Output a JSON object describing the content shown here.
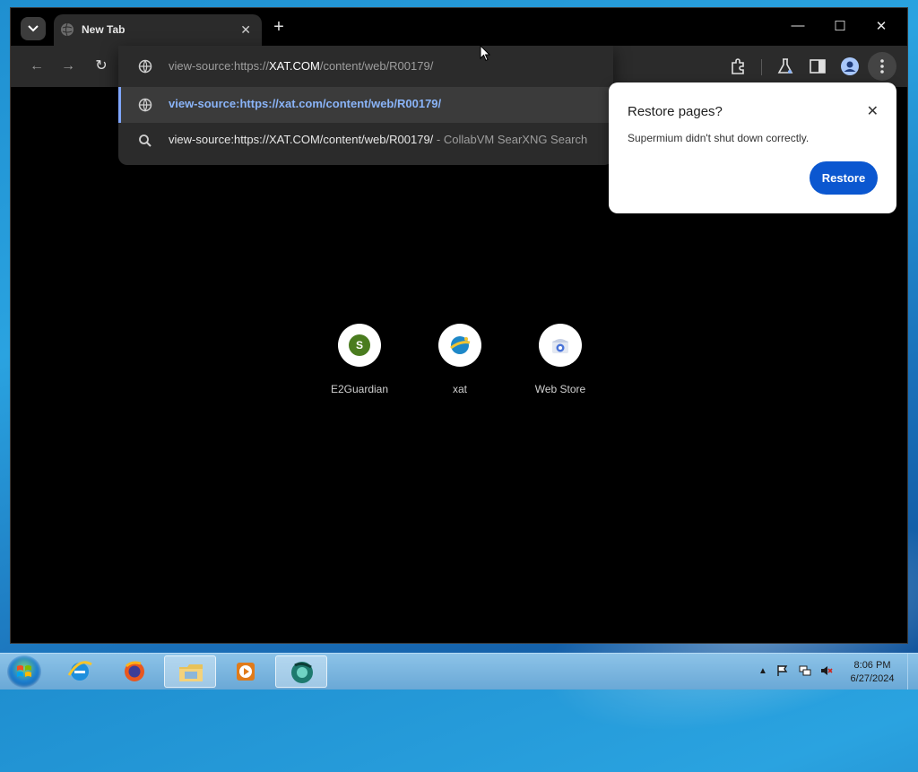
{
  "tab": {
    "title": "New Tab"
  },
  "omnibox": {
    "input_prefix": "view-source:https://",
    "input_host": "XAT.COM",
    "input_path": "/content/web/R00179/",
    "suggestion_url": "view-source:https://xat.com/content/web/R00179/",
    "search_query": "view-source:https://XAT.COM/content/web/R00179/",
    "search_suffix": "- CollabVM SearXNG Search"
  },
  "restore": {
    "title": "Restore pages?",
    "message": "Supermium didn't shut down correctly.",
    "button": "Restore"
  },
  "shortcuts": [
    {
      "label": "E2Guardian",
      "letter": "S",
      "color": "#4a7c1f"
    },
    {
      "label": "xat",
      "icon": "xat-globe-icon"
    },
    {
      "label": "Web Store",
      "icon": "web-store-icon"
    }
  ],
  "clock": {
    "time": "8:06 PM",
    "date": "6/27/2024"
  },
  "colors": {
    "accent": "#0b57d0",
    "selected_text": "#8ab4f8"
  }
}
